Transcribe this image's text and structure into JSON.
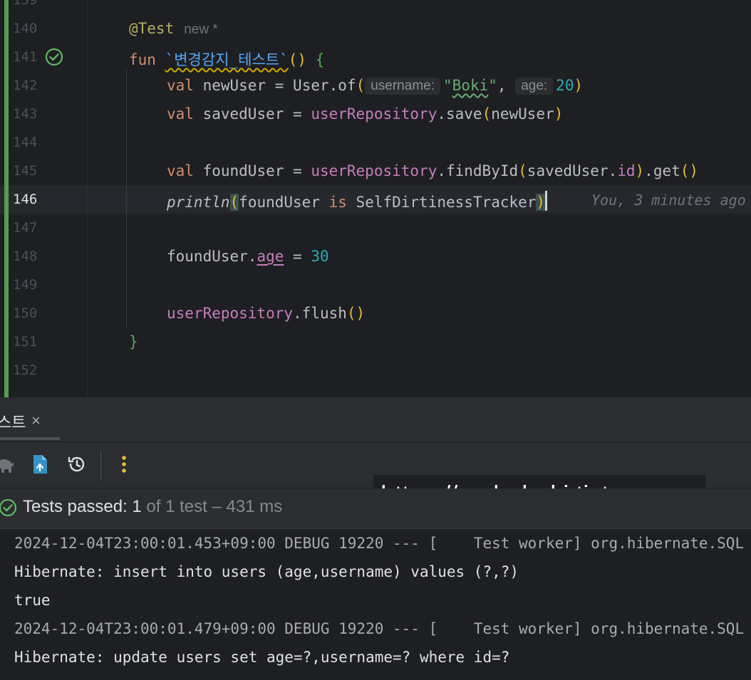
{
  "editor": {
    "line_numbers": [
      "140",
      "141",
      "142",
      "143",
      "144",
      "145",
      "146",
      "147",
      "148",
      "149",
      "150",
      "151",
      "152"
    ],
    "annotation": "@Test",
    "annotation_hint": "new *",
    "kw_fun": "fun",
    "test_name": "`변경감지_테스트`",
    "paren_open": "(",
    "paren_close": ")",
    "paren_pair": "()",
    "brace_open": "{",
    "brace_close": "}",
    "kw_val": "val",
    "var_newUser": "newUser",
    "equals": " = ",
    "user_of": "User.of",
    "hint_username": "username:",
    "str_quote_open": "\"",
    "str_boki": "Boki",
    "str_quote_close": "\"",
    "comma": ", ",
    "hint_age": "age:",
    "num_20": "20",
    "var_savedUser": "savedUser",
    "repo": "userRepository",
    "save_call": ".save",
    "arg_newUser": "newUser",
    "var_foundUser": "foundUser",
    "findById": ".findById",
    "arg_savedUser": "savedUser.",
    "prop_id": "id",
    "get_call": ".get",
    "println": "println",
    "arg_foundUser": "foundUser ",
    "kw_is": "is",
    "type_tracker": " SelfDirtinessTracker",
    "blame": "You, 3 minutes ago",
    "assign_obj": "foundUser.",
    "prop_age": "age",
    "num_30": "30",
    "flush_call": ".flush"
  },
  "panel": {
    "tab_label": "스트",
    "tab_close": "×",
    "watermark": "https://code-boki.tistory.com",
    "status_main": "Tests passed: 1",
    "status_muted": " of 1 test – 431 ms",
    "console_lines": [
      "2024-12-04T23:00:01.453+09:00 DEBUG 19220 --- [    Test worker] org.hibernate.SQL",
      "Hibernate: insert into users (age,username) values (?,?)",
      "true",
      "2024-12-04T23:00:01.479+09:00 DEBUG 19220 --- [    Test worker] org.hibernate.SQL",
      "Hibernate: update users set age=?,username=? where id=?"
    ]
  },
  "icons": {
    "run_passed": "check-circle-icon",
    "gradle": "elephant-icon",
    "export": "file-export-icon",
    "history": "history-icon",
    "more": "more-vertical-icon",
    "tests_passed": "check-circle-icon"
  },
  "colors": {
    "pass": "#5fb865",
    "accent_blue": "#3592c4",
    "more_dots": "#e8b83b"
  }
}
